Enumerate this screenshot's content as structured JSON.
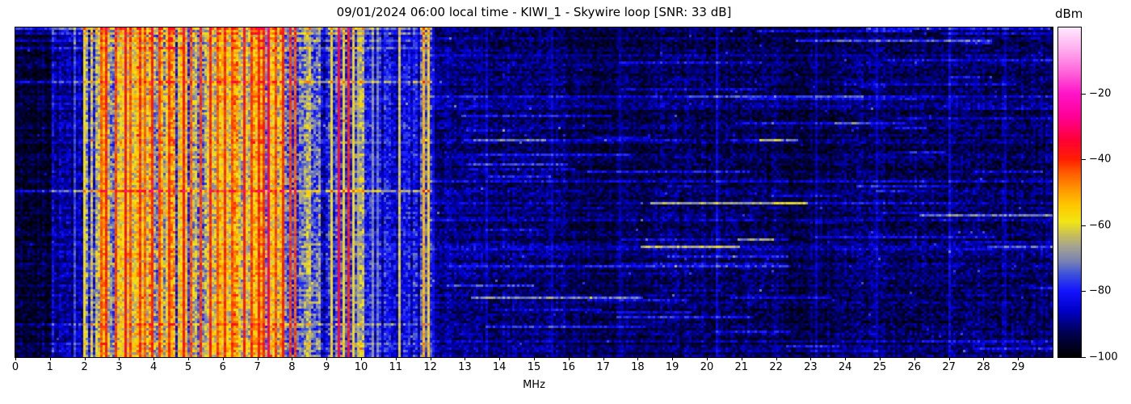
{
  "chart_data": {
    "type": "heatmap",
    "subtype": "radio-spectrum-waterfall",
    "title": "09/01/2024 06:00 local time - KIWI_1 - Skywire loop [SNR: 33 dB]",
    "datetime_local": "09/01/2024 06:00",
    "receiver": "KIWI_1",
    "antenna": "Skywire loop",
    "snr_db": 33,
    "xlabel": "MHz",
    "x_range_mhz": [
      0,
      30
    ],
    "x_ticks": [
      0,
      1,
      2,
      3,
      4,
      5,
      6,
      7,
      8,
      9,
      10,
      11,
      12,
      13,
      14,
      15,
      16,
      17,
      18,
      19,
      20,
      21,
      22,
      23,
      24,
      25,
      26,
      27,
      28,
      29
    ],
    "y_axis": "time (no tick labels shown)",
    "grid": false,
    "colorbar": {
      "label": "dBm",
      "range_top_to_bottom": [
        0,
        -100
      ],
      "ticks": [
        -20,
        -40,
        -60,
        -80,
        -100
      ],
      "tick_labels": [
        "−20",
        "−40",
        "−60",
        "−80",
        "−100"
      ],
      "stops": [
        [
          -100,
          "#000000"
        ],
        [
          -93,
          "#00004e"
        ],
        [
          -86,
          "#0000c8"
        ],
        [
          -80,
          "#1414ff"
        ],
        [
          -75,
          "#3c50dc"
        ],
        [
          -71,
          "#7882b4"
        ],
        [
          -67,
          "#a0a096"
        ],
        [
          -63,
          "#c8be5a"
        ],
        [
          -59,
          "#f0e614"
        ],
        [
          -54,
          "#ffc800"
        ],
        [
          -49,
          "#ff9600"
        ],
        [
          -44,
          "#ff5a00"
        ],
        [
          -40,
          "#ff1e00"
        ],
        [
          -34,
          "#ff0037"
        ],
        [
          -27,
          "#ff0096"
        ],
        [
          -20,
          "#ff14c8"
        ],
        [
          -13,
          "#ff69dc"
        ],
        [
          -6,
          "#ffb4f0"
        ],
        [
          0,
          "#ffe6ff"
        ]
      ]
    },
    "bands_dbm": [
      {
        "f0": 0.0,
        "f1": 1.05,
        "base": -95,
        "col_var": 3,
        "cell_noise": 5
      },
      {
        "f0": 1.05,
        "f1": 2.02,
        "base": -87,
        "col_var": 4,
        "cell_noise": 6
      },
      {
        "f0": 2.02,
        "f1": 2.45,
        "base": -71,
        "col_var": 12,
        "cell_noise": 9
      },
      {
        "f0": 2.45,
        "f1": 3.0,
        "base": -63,
        "col_var": 12,
        "cell_noise": 9
      },
      {
        "f0": 3.0,
        "f1": 4.6,
        "base": -60,
        "col_var": 11,
        "cell_noise": 9
      },
      {
        "f0": 4.6,
        "f1": 5.4,
        "base": -69,
        "col_var": 13,
        "cell_noise": 9
      },
      {
        "f0": 5.4,
        "f1": 6.0,
        "base": -64,
        "col_var": 12,
        "cell_noise": 9
      },
      {
        "f0": 6.0,
        "f1": 7.55,
        "base": -60,
        "col_var": 11,
        "cell_noise": 9
      },
      {
        "f0": 7.55,
        "f1": 8.25,
        "base": -66,
        "col_var": 13,
        "cell_noise": 9
      },
      {
        "f0": 8.25,
        "f1": 8.8,
        "base": -72,
        "col_var": 12,
        "cell_noise": 9
      },
      {
        "f0": 8.8,
        "f1": 9.3,
        "base": -80,
        "col_var": 7,
        "cell_noise": 8
      },
      {
        "f0": 9.3,
        "f1": 10.1,
        "base": -71,
        "col_var": 9,
        "cell_noise": 9
      },
      {
        "f0": 10.1,
        "f1": 11.7,
        "base": -83,
        "col_var": 5,
        "cell_noise": 7
      },
      {
        "f0": 11.7,
        "f1": 12.05,
        "base": -74,
        "col_var": 6,
        "cell_noise": 7
      },
      {
        "f0": 12.05,
        "f1": 13.5,
        "base": -90,
        "col_var": 2,
        "cell_noise": 6
      },
      {
        "f0": 13.5,
        "f1": 16.0,
        "base": -91,
        "col_var": 2,
        "cell_noise": 6
      },
      {
        "f0": 16.0,
        "f1": 18.5,
        "base": -93,
        "col_var": 2,
        "cell_noise": 5
      },
      {
        "f0": 18.5,
        "f1": 22.0,
        "base": -92,
        "col_var": 2,
        "cell_noise": 6
      },
      {
        "f0": 22.0,
        "f1": 24.0,
        "base": -93,
        "col_var": 2,
        "cell_noise": 5
      },
      {
        "f0": 24.0,
        "f1": 30.0,
        "base": -92,
        "col_var": 2,
        "cell_noise": 6
      }
    ],
    "carrier_lines": [
      {
        "f": 1.7,
        "level": -76
      },
      {
        "f": 1.97,
        "level": -58
      },
      {
        "f": 2.5,
        "level": -44
      },
      {
        "f": 2.62,
        "level": -40
      },
      {
        "f": 2.88,
        "level": -42
      },
      {
        "f": 3.2,
        "level": -38
      },
      {
        "f": 3.32,
        "level": -44
      },
      {
        "f": 3.6,
        "level": -41
      },
      {
        "f": 3.75,
        "level": -45
      },
      {
        "f": 3.98,
        "level": -40
      },
      {
        "f": 4.2,
        "level": -43
      },
      {
        "f": 4.47,
        "level": -41
      },
      {
        "f": 4.85,
        "level": -39
      },
      {
        "f": 5.06,
        "level": -44
      },
      {
        "f": 5.33,
        "level": -42
      },
      {
        "f": 5.62,
        "level": -40
      },
      {
        "f": 5.85,
        "level": -44
      },
      {
        "f": 6.07,
        "level": -41
      },
      {
        "f": 6.3,
        "level": -43
      },
      {
        "f": 6.62,
        "level": -39
      },
      {
        "f": 6.8,
        "level": -42
      },
      {
        "f": 7.05,
        "level": -40
      },
      {
        "f": 7.2,
        "level": -41
      },
      {
        "f": 7.35,
        "level": -33
      },
      {
        "f": 7.5,
        "level": -43
      },
      {
        "f": 7.72,
        "level": -40
      },
      {
        "f": 7.95,
        "level": -42
      },
      {
        "f": 8.12,
        "level": -44
      },
      {
        "f": 9.18,
        "level": -58
      },
      {
        "f": 9.35,
        "level": -35
      },
      {
        "f": 9.5,
        "level": -57
      },
      {
        "f": 9.67,
        "level": -40
      },
      {
        "f": 9.77,
        "level": -58
      },
      {
        "f": 9.9,
        "level": -65
      },
      {
        "f": 10.35,
        "level": -70
      },
      {
        "f": 10.5,
        "level": -72
      },
      {
        "f": 11.08,
        "level": -62
      },
      {
        "f": 11.8,
        "level": -52
      },
      {
        "f": 11.92,
        "level": -56
      },
      {
        "f": 12.12,
        "level": -82
      },
      {
        "f": 13.6,
        "level": -85
      },
      {
        "f": 15.55,
        "level": -86
      },
      {
        "f": 17.5,
        "level": -88
      },
      {
        "f": 20.3,
        "level": -84
      },
      {
        "f": 23.2,
        "level": -87
      },
      {
        "f": 24.9,
        "level": -86
      },
      {
        "f": 27.0,
        "level": -84
      },
      {
        "f": 28.6,
        "level": -87
      }
    ],
    "texture": {
      "seed": 20240901,
      "rows": 136,
      "cols": 428,
      "row_jitter": 2.5,
      "impulse_chance": 0.004,
      "impulse_boost": 12,
      "top_rows": {
        "rows": 2,
        "f_max": 2.05,
        "boost": 5
      },
      "streaks": {
        "quiet_count": 75,
        "quiet_f": [
          12.0,
          29.8
        ],
        "len": [
          0.4,
          6.0
        ],
        "boost": [
          4,
          13
        ],
        "bright_chance": 0.12,
        "bright_boost": [
          16,
          25
        ],
        "full_count": 9,
        "full_boost": [
          4,
          8
        ],
        "busy_count": 8,
        "busy_boost": [
          6,
          12
        ]
      }
    }
  }
}
